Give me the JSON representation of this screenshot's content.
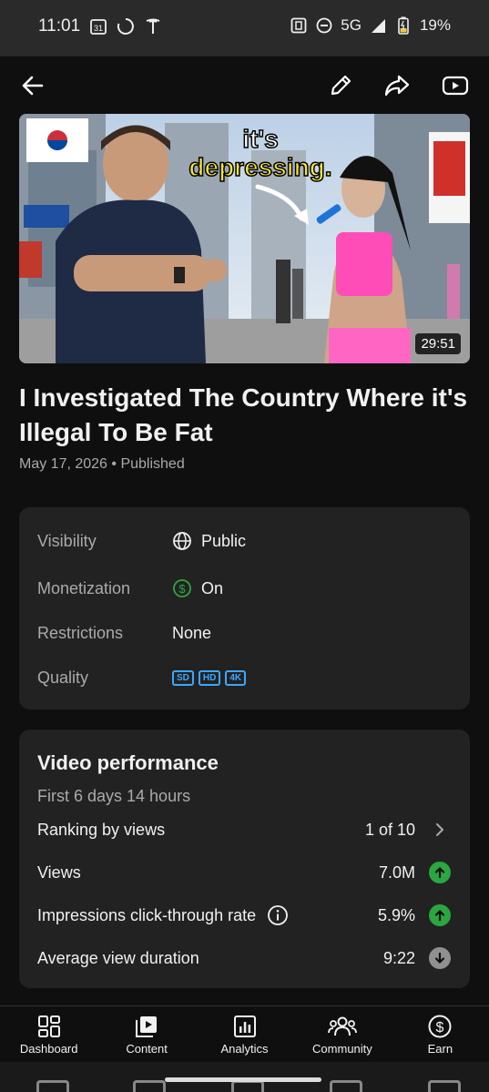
{
  "status_bar": {
    "time": "11:01",
    "calendar_day": "31",
    "network": "5G",
    "battery": "19%"
  },
  "video": {
    "duration": "29:51",
    "title": "I Investigated The Country Where it's Illegal To Be Fat",
    "date": "May 17, 2026",
    "status": "Published",
    "thumbnail_text": "it's depressing."
  },
  "details": {
    "visibility_label": "Visibility",
    "visibility_value": "Public",
    "monetization_label": "Monetization",
    "monetization_value": "On",
    "restrictions_label": "Restrictions",
    "restrictions_value": "None",
    "quality_label": "Quality",
    "quality_badges": [
      "SD",
      "HD",
      "4K"
    ]
  },
  "performance": {
    "title": "Video performance",
    "subtitle": "First 6 days 14 hours",
    "ranking_label": "Ranking by views",
    "ranking_value": "1 of 10",
    "views_label": "Views",
    "views_value": "7.0M",
    "ctr_label": "Impressions click-through rate",
    "ctr_value": "5.9%",
    "avd_label": "Average view duration",
    "avd_value": "9:22"
  },
  "nav": {
    "dashboard": "Dashboard",
    "content": "Content",
    "analytics": "Analytics",
    "community": "Community",
    "earn": "Earn"
  },
  "colors": {
    "accent_blue": "#3ea6ff",
    "up_green": "#2ba640",
    "neutral_grey": "#909090",
    "card_bg": "#222222"
  }
}
